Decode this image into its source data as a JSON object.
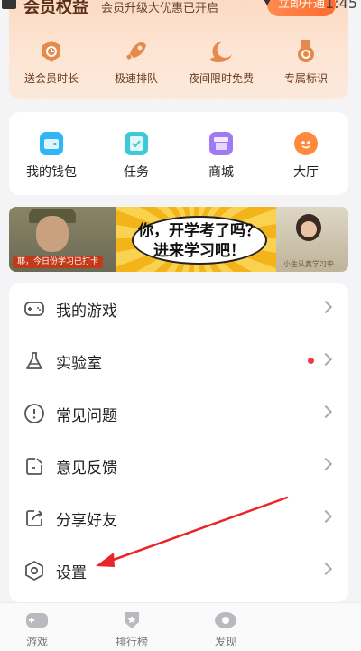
{
  "status": {
    "time": "1:45"
  },
  "vip": {
    "title": "会员权益",
    "subtitle": "会员升级大优惠已开启",
    "button": "立即开通",
    "items": [
      {
        "label": "送会员时长",
        "icon": "clock-icon"
      },
      {
        "label": "极速排队",
        "icon": "rocket-icon"
      },
      {
        "label": "夜间限时免费",
        "icon": "moon-icon"
      },
      {
        "label": "专属标识",
        "icon": "medal-icon"
      }
    ]
  },
  "quick": {
    "items": [
      {
        "label": "我的钱包",
        "icon": "wallet-icon",
        "color": "#2fb6f5"
      },
      {
        "label": "任务",
        "icon": "task-icon",
        "color": "#3ec9d6"
      },
      {
        "label": "商城",
        "icon": "store-icon",
        "color": "#a07af2"
      },
      {
        "label": "大厅",
        "icon": "lobby-icon",
        "color": "#ff8a3d"
      }
    ]
  },
  "banner": {
    "headline_line1": "你，开学考了吗？",
    "headline_line2": "进来学习吧！",
    "tag": "耶，今日份学习已打卡",
    "caption": "小生认真学习中"
  },
  "menu": {
    "items": [
      {
        "label": "我的游戏",
        "icon": "gamepad-icon"
      },
      {
        "label": "实验室",
        "icon": "flask-icon"
      },
      {
        "label": "常见问题",
        "icon": "alert-circle-icon"
      },
      {
        "label": "意见反馈",
        "icon": "feedback-icon"
      },
      {
        "label": "分享好友",
        "icon": "share-icon"
      },
      {
        "label": "设置",
        "icon": "settings-hexagon-icon"
      }
    ]
  },
  "tabs": [
    {
      "label": "游戏",
      "icon": "gamepad-tab-icon"
    },
    {
      "label": "排行榜",
      "icon": "ranking-icon"
    },
    {
      "label": "发现",
      "icon": "discover-icon"
    }
  ],
  "colors": {
    "accent": "#ff6a2e",
    "vip_text": "#6b3a1e",
    "red_dot": "#f23a4a",
    "annotation": "#e8262a"
  }
}
